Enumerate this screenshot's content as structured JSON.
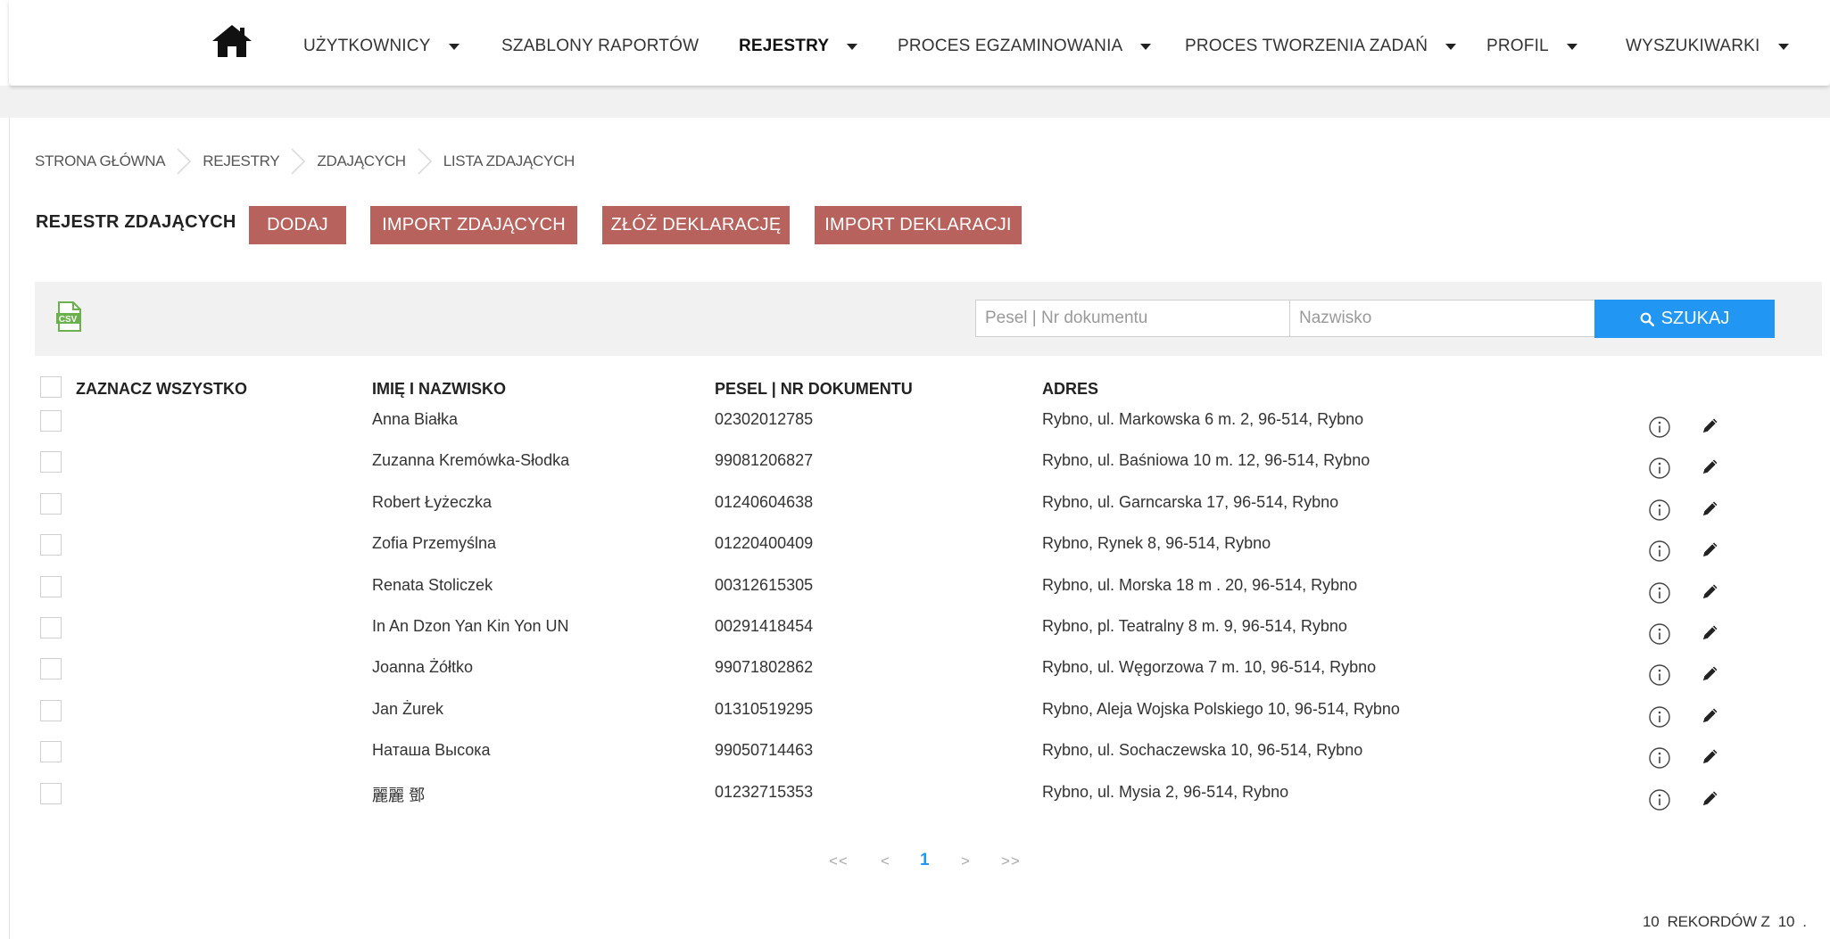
{
  "nav": {
    "items": [
      {
        "label": "UŻYTKOWNICY",
        "dropdown": true
      },
      {
        "label": "SZABLONY RAPORTÓW",
        "dropdown": false
      },
      {
        "label": "REJESTRY",
        "dropdown": true,
        "active": true
      },
      {
        "label": "PROCES EGZAMINOWANIA",
        "dropdown": true
      },
      {
        "label": "PROCES TWORZENIA ZADAŃ",
        "dropdown": true
      },
      {
        "label": "PROFIL",
        "dropdown": true
      },
      {
        "label": "WYSZUKIWARKI",
        "dropdown": true
      }
    ],
    "home_icon": "home-icon"
  },
  "breadcrumb": [
    "STRONA GŁÓWNA",
    "REJESTRY",
    "ZDAJĄCYCH",
    "LISTA ZDAJĄCYCH"
  ],
  "page": {
    "title": "REJESTR ZDAJĄCYCH",
    "buttons": [
      "DODAJ",
      "IMPORT ZDAJĄCYCH",
      "ZŁÓŻ DEKLARACJĘ",
      "IMPORT DEKLARACJI"
    ]
  },
  "search": {
    "csv_icon": "csv-export-icon",
    "pesel_placeholder": "Pesel | Nr dokumentu",
    "surname_placeholder": "Nazwisko",
    "button_label": "SZUKAJ"
  },
  "table": {
    "select_all": "ZAZNACZ WSZYSTKO",
    "headers": {
      "name": "IMIĘ I NAZWISKO",
      "pesel": "PESEL | NR DOKUMENTU",
      "address": "ADRES"
    },
    "rows": [
      {
        "name": "Anna Białka",
        "pesel": "02302012785",
        "address": "Rybno, ul. Markowska 6 m. 2, 96-514, Rybno"
      },
      {
        "name": "Zuzanna Kremówka-Słodka",
        "pesel": "99081206827",
        "address": "Rybno, ul. Baśniowa 10 m. 12, 96-514, Rybno"
      },
      {
        "name": "Robert Łyżeczka",
        "pesel": "01240604638",
        "address": "Rybno, ul. Garncarska 17, 96-514, Rybno"
      },
      {
        "name": "Zofia Przemyślna",
        "pesel": "01220400409",
        "address": "Rybno, Rynek 8, 96-514, Rybno"
      },
      {
        "name": "Renata Stoliczek",
        "pesel": "00312615305",
        "address": "Rybno, ul. Morska 18 m . 20, 96-514, Rybno"
      },
      {
        "name": "In An Dzon Yan Kin Yon UN",
        "pesel": "00291418454",
        "address": "Rybno, pl. Teatralny 8 m. 9, 96-514, Rybno"
      },
      {
        "name": "Joanna Żółtko",
        "pesel": "99071802862",
        "address": "Rybno, ul. Węgorzowa 7 m. 10, 96-514, Rybno"
      },
      {
        "name": "Jan Żurek",
        "pesel": "01310519295",
        "address": "Rybno, Aleja Wojska Polskiego 10, 96-514, Rybno"
      },
      {
        "name": "Наташа Высока",
        "pesel": "99050714463",
        "address": "Rybno, ul. Sochaczewska 10, 96-514, Rybno"
      },
      {
        "name": "麗麗 鄧",
        "pesel": "01232715353",
        "address": "Rybno, ul. Mysia 2, 96-514, Rybno"
      }
    ],
    "row_icons": [
      "info-icon",
      "edit-icon"
    ]
  },
  "pagination": {
    "first": "<<",
    "prev": "<",
    "current": "1",
    "next": ">",
    "last": ">>"
  },
  "records": {
    "count": "10",
    "label": "REKORDÓW Z",
    "total": "10",
    "suffix": "."
  },
  "colors": {
    "primary_button": "#b7625c",
    "search_button": "#2196f3",
    "current_page": "#2196f3"
  }
}
